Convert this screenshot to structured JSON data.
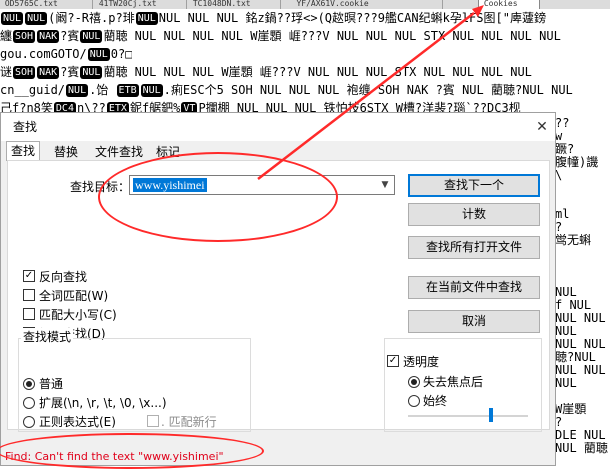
{
  "editor": {
    "tabs": [
      {
        "label": "OD5765C.txt",
        "active": false
      },
      {
        "label": "41TW20Cj.txt",
        "active": false
      },
      {
        "label": "TC1048DN.txt",
        "active": false
      },
      {
        "label": "YF/AX61V.cookie",
        "active": false
      },
      {
        "label": "Cookies",
        "active": true
      }
    ],
    "lines": [
      {
        "pre": "",
        "tok1": "NUL",
        "mid": "",
        "tok2": "NUL",
        "post": "(阚?-R禧.p?琲",
        "tok3": "NUL",
        "tail": "NUL NUL NUL 銘z鍋??琈<>(Q趑暝???9艦CAN纪蝌k孕lFS图[\"庳蘧鎊"
      },
      {
        "pre": "纏",
        "tok1": "SOH",
        "mid": "",
        "tok2": "NAK",
        "post": "?賓",
        "tok3": "NUL",
        "tail": "藺聴 NUL NUL NUL NUL W崖顋 崕???V NUL NUL NUL STX NUL NUL NUL NUL"
      },
      {
        "pre": "gou.comGOTO/",
        "tok1": "NUL",
        "mid": "",
        "tok2": "",
        "post": "0?□",
        "tok3": "",
        "tail": ""
      },
      {
        "pre": "谜",
        "tok1": "SOH",
        "mid": "",
        "tok2": "NAK",
        "post": "?賓",
        "tok3": "NUL",
        "tail": "藺聴 NUL NUL NUL W崖顋 崕???V NUL NUL NUL STX NUL NUL NUL NUL"
      },
      {
        "pre": "cn__guid/",
        "tok1": "NUL",
        "mid": ".饴 ",
        "tok2": "ETB",
        "post": "",
        "tok3": "NUL",
        "tail": ".痢ESC个5 SOH NUL NUL NUL 袍缠 SOH NAK ?賓 NUL 藺聴?NUL NUL"
      },
      {
        "pre": "己f?n8笑",
        "tok1": "DC4",
        "mid": "n\\??",
        "tok2": "ETX",
        "post": "鈮f艍鈀%",
        "tok3": "VT",
        "tail": "P攔棚 NUL NUL NUL 铁怕技6STX W槽?洋裴?瑙`??DC3枧"
      }
    ],
    "right_lines": [
      "??",
      "w",
      "蹶?",
      "腹幢)譏",
      "\\",
      "",
      "",
      "ml",
      "?",
      "鸴无蝌",
      "",
      "",
      "",
      "NUL",
      "f NUL",
      "NUL NUL",
      "NUL",
      "NUL NUL",
      "聴?NUL",
      "NUL NUL",
      "NUL",
      "",
      "W崖顋",
      "?",
      "DLE NUL",
      "NUL 藺聴"
    ]
  },
  "dialog": {
    "title": "查找",
    "close_symbol": "✕",
    "tabs": [
      "查找",
      "替换",
      "文件查找",
      "标记"
    ],
    "active_tab": 0,
    "search_label": "查找目标：",
    "search_value": "www.yishimei",
    "buttons": {
      "find_next": "查找下一个",
      "count": "计数",
      "find_all_open": "查找所有打开文件",
      "find_all_current": "在当前文件中查找",
      "cancel": "取消"
    },
    "options": [
      {
        "label": "反向查找",
        "checked": true
      },
      {
        "label": "全词匹配(W)",
        "checked": false
      },
      {
        "label": "匹配大小写(C)",
        "checked": false
      },
      {
        "label": "循环查找(D)",
        "checked": true
      }
    ],
    "mode": {
      "title": "查找模式",
      "options": [
        {
          "label": "普通",
          "selected": true
        },
        {
          "label": "扩展(\\n, \\r, \\t, \\0, \\x...)",
          "selected": false
        },
        {
          "label": "正则表达式(E)",
          "selected": false
        }
      ],
      "dot_newline": ". 匹配新行"
    },
    "transparency": {
      "title": "透明度",
      "enabled": true,
      "options": [
        {
          "label": "失去焦点后",
          "selected": true
        },
        {
          "label": "始终",
          "selected": false
        }
      ],
      "level": 0.7
    },
    "status": "Find: Can't find the text \"www.yishimei\""
  },
  "annotation_color": "#ff2a2a",
  "accent_color": "#0078d7",
  "status_color": "#e0001a"
}
